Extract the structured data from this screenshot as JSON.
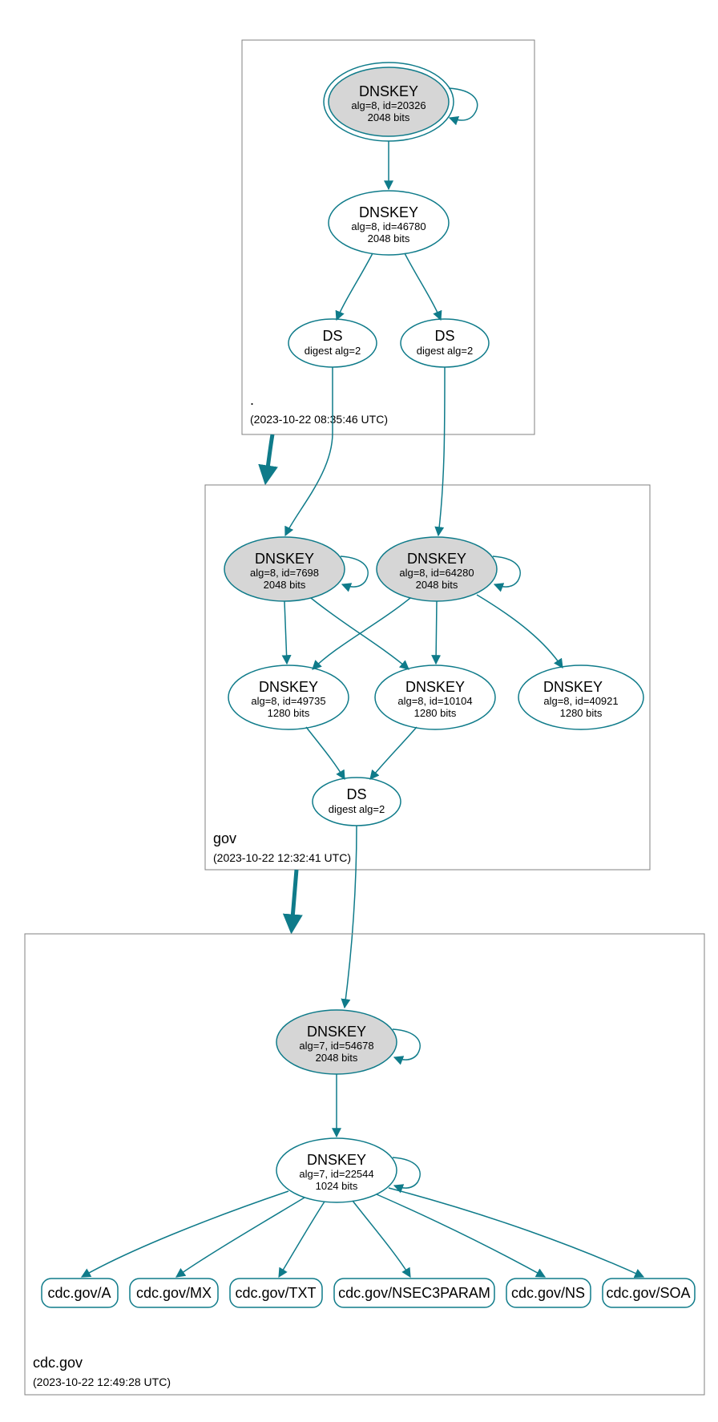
{
  "zones": {
    "root": {
      "label": ".",
      "timestamp": "(2023-10-22 08:35:46 UTC)",
      "nodes": {
        "k0": {
          "title": "DNSKEY",
          "line2": "alg=8, id=20326",
          "line3": "2048 bits"
        },
        "k1": {
          "title": "DNSKEY",
          "line2": "alg=8, id=46780",
          "line3": "2048 bits"
        },
        "ds0": {
          "title": "DS",
          "line2": "digest alg=2"
        },
        "ds1": {
          "title": "DS",
          "line2": "digest alg=2"
        }
      }
    },
    "gov": {
      "label": "gov",
      "timestamp": "(2023-10-22 12:32:41 UTC)",
      "nodes": {
        "k2": {
          "title": "DNSKEY",
          "line2": "alg=8, id=7698",
          "line3": "2048 bits"
        },
        "k3": {
          "title": "DNSKEY",
          "line2": "alg=8, id=64280",
          "line3": "2048 bits"
        },
        "k4": {
          "title": "DNSKEY",
          "line2": "alg=8, id=49735",
          "line3": "1280 bits"
        },
        "k5": {
          "title": "DNSKEY",
          "line2": "alg=8, id=10104",
          "line3": "1280 bits"
        },
        "k6": {
          "title": "DNSKEY",
          "line2": "alg=8, id=40921",
          "line3": "1280 bits"
        },
        "ds2": {
          "title": "DS",
          "line2": "digest alg=2"
        }
      }
    },
    "cdc": {
      "label": "cdc.gov",
      "timestamp": "(2023-10-22 12:49:28 UTC)",
      "nodes": {
        "k7": {
          "title": "DNSKEY",
          "line2": "alg=7, id=54678",
          "line3": "2048 bits"
        },
        "k8": {
          "title": "DNSKEY",
          "line2": "alg=7, id=22544",
          "line3": "1024 bits"
        }
      }
    }
  },
  "rr": {
    "a": "cdc.gov/A",
    "mx": "cdc.gov/MX",
    "txt": "cdc.gov/TXT",
    "nsec3": "cdc.gov/NSEC3PARAM",
    "ns": "cdc.gov/NS",
    "soa": "cdc.gov/SOA"
  },
  "colors": {
    "stroke": "#0f7b8a",
    "box": "#808080",
    "fill_grey": "#d6d6d6",
    "warn_fill": "#f6d250"
  }
}
